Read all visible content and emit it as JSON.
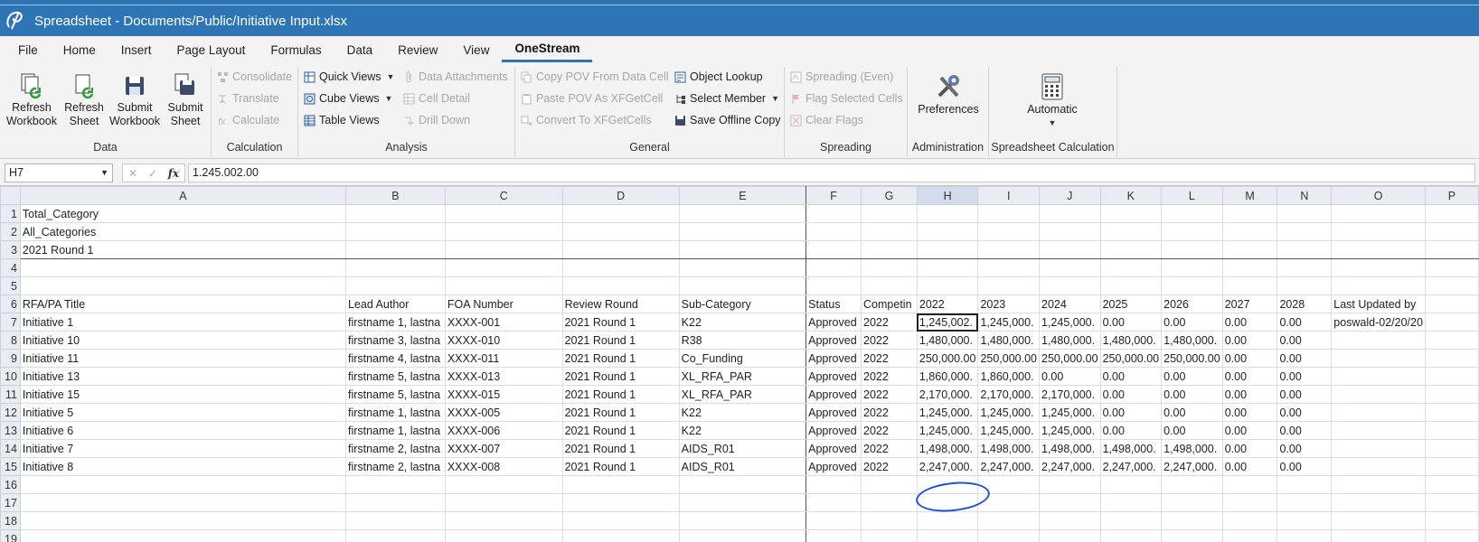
{
  "window": {
    "title": "Spreadsheet - Documents/Public/Initiative Input.xlsx"
  },
  "menu": [
    "File",
    "Home",
    "Insert",
    "Page Layout",
    "Formulas",
    "Data",
    "Review",
    "View",
    "OneStream"
  ],
  "active_menu": "OneStream",
  "ribbon": {
    "data": {
      "label": "Data",
      "buttons": [
        {
          "line1": "Refresh",
          "line2": "Workbook"
        },
        {
          "line1": "Refresh",
          "line2": "Sheet"
        },
        {
          "line1": "Submit",
          "line2": "Workbook"
        },
        {
          "line1": "Submit",
          "line2": "Sheet"
        }
      ]
    },
    "calculation": {
      "label": "Calculation",
      "items": [
        "Consolidate",
        "Translate",
        "Calculate"
      ]
    },
    "analysis": {
      "label": "Analysis",
      "items": [
        "Quick Views",
        "Cube Views",
        "Table Views",
        "Data Attachments",
        "Cell Detail",
        "Drill Down"
      ]
    },
    "general": {
      "label": "General",
      "items": [
        "Copy POV From Data Cell",
        "Paste POV As XFGetCell",
        "Convert To XFGetCells",
        "Object Lookup",
        "Select Member",
        "Save Offline Copy"
      ]
    },
    "spreading": {
      "label": "Spreading",
      "items": [
        "Spreading (Even)",
        "Flag Selected Cells",
        "Clear Flags"
      ]
    },
    "administration": {
      "label": "Administration",
      "button": "Preferences"
    },
    "spreadsheet_calc": {
      "label": "Spreadsheet Calculation",
      "button": "Automatic"
    }
  },
  "formula_bar": {
    "name_box": "H7",
    "formula": "1.245.002.00"
  },
  "columns": [
    "A",
    "B",
    "C",
    "D",
    "E",
    "F",
    "G",
    "H",
    "I",
    "J",
    "K",
    "L",
    "M",
    "N",
    "O",
    "P"
  ],
  "selected_column": "H",
  "rows": [
    {
      "n": "1",
      "cells": [
        "Total_Category",
        "",
        "",
        "",
        "",
        "",
        "",
        "",
        "",
        "",
        "",
        "",
        "",
        "",
        "",
        ""
      ]
    },
    {
      "n": "2",
      "cells": [
        "All_Categories",
        "",
        "",
        "",
        "",
        "",
        "",
        "",
        "",
        "",
        "",
        "",
        "",
        "",
        "",
        ""
      ]
    },
    {
      "n": "3",
      "cells": [
        "2021 Round 1",
        "",
        "",
        "",
        "",
        "",
        "",
        "",
        "",
        "",
        "",
        "",
        "",
        "",
        "",
        ""
      ]
    },
    {
      "n": "4",
      "cells": [
        "",
        "",
        "",
        "",
        "",
        "",
        "",
        "",
        "",
        "",
        "",
        "",
        "",
        "",
        "",
        ""
      ]
    },
    {
      "n": "5",
      "cells": [
        "",
        "",
        "",
        "",
        "",
        "",
        "",
        "",
        "",
        "",
        "",
        "",
        "",
        "",
        "",
        ""
      ]
    },
    {
      "n": "6",
      "cells": [
        "RFA/PA Title",
        "Lead Author",
        "FOA Number",
        "Review Round",
        "Sub-Category",
        "Status",
        "Competin",
        "2022",
        "2023",
        "2024",
        "2025",
        "2026",
        "2027",
        "2028",
        "Last Updated by",
        ""
      ]
    },
    {
      "n": "7",
      "cells": [
        "Initiative 1",
        "firstname 1, lastna",
        "XXXX-001",
        "2021 Round 1",
        "K22",
        "Approved",
        "2022",
        "1,245,002.",
        "1,245,000.",
        "1,245,000.",
        "0.00",
        "0.00",
        "0.00",
        "0.00",
        "poswald-02/20/20",
        ""
      ]
    },
    {
      "n": "8",
      "cells": [
        "Initiative 10",
        "firstname 3, lastna",
        "XXXX-010",
        "2021 Round 1",
        "R38",
        "Approved",
        "2022",
        "1,480,000.",
        "1,480,000.",
        "1,480,000.",
        "1,480,000.",
        "1,480,000.",
        "0.00",
        "0.00",
        "",
        ""
      ]
    },
    {
      "n": "9",
      "cells": [
        "Initiative 11",
        "firstname 4, lastna",
        "XXXX-011",
        "2021 Round 1",
        "Co_Funding",
        "Approved",
        "2022",
        "250,000.00",
        "250,000.00",
        "250,000.00",
        "250,000.00",
        "250,000.00",
        "0.00",
        "0.00",
        "",
        ""
      ]
    },
    {
      "n": "10",
      "cells": [
        "Initiative 13",
        "firstname 5, lastna",
        "XXXX-013",
        "2021 Round 1",
        "XL_RFA_PAR",
        "Approved",
        "2022",
        "1,860,000.",
        "1,860,000.",
        "0.00",
        "0.00",
        "0.00",
        "0.00",
        "0.00",
        "",
        ""
      ]
    },
    {
      "n": "11",
      "cells": [
        "Initiative 15",
        "firstname 5, lastna",
        "XXXX-015",
        "2021 Round 1",
        "XL_RFA_PAR",
        "Approved",
        "2022",
        "2,170,000.",
        "2,170,000.",
        "2,170,000.",
        "0.00",
        "0.00",
        "0.00",
        "0.00",
        "",
        ""
      ]
    },
    {
      "n": "12",
      "cells": [
        "Initiative 5",
        "firstname 1, lastna",
        "XXXX-005",
        "2021 Round 1",
        "K22",
        "Approved",
        "2022",
        "1,245,000.",
        "1,245,000.",
        "1,245,000.",
        "0.00",
        "0.00",
        "0.00",
        "0.00",
        "",
        ""
      ]
    },
    {
      "n": "13",
      "cells": [
        "Initiative 6",
        "firstname 1, lastna",
        "XXXX-006",
        "2021 Round 1",
        "K22",
        "Approved",
        "2022",
        "1,245,000.",
        "1,245,000.",
        "1,245,000.",
        "0.00",
        "0.00",
        "0.00",
        "0.00",
        "",
        ""
      ]
    },
    {
      "n": "14",
      "cells": [
        "Initiative 7",
        "firstname 2, lastna",
        "XXXX-007",
        "2021 Round 1",
        "AIDS_R01",
        "Approved",
        "2022",
        "1,498,000.",
        "1,498,000.",
        "1,498,000.",
        "1,498,000.",
        "1,498,000.",
        "0.00",
        "0.00",
        "",
        ""
      ]
    },
    {
      "n": "15",
      "cells": [
        "Initiative 8",
        "firstname 2, lastna",
        "XXXX-008",
        "2021 Round 1",
        "AIDS_R01",
        "Approved",
        "2022",
        "2,247,000.",
        "2,247,000.",
        "2,247,000.",
        "2,247,000.",
        "2,247,000.",
        "0.00",
        "0.00",
        "",
        ""
      ]
    },
    {
      "n": "16",
      "cells": [
        "",
        "",
        "",
        "",
        "",
        "",
        "",
        "",
        "",
        "",
        "",
        "",
        "",
        "",
        "",
        ""
      ]
    },
    {
      "n": "17",
      "cells": [
        "",
        "",
        "",
        "",
        "",
        "",
        "",
        "",
        "",
        "",
        "",
        "",
        "",
        "",
        "",
        ""
      ]
    },
    {
      "n": "18",
      "cells": [
        "",
        "",
        "",
        "",
        "",
        "",
        "",
        "",
        "",
        "",
        "",
        "",
        "",
        "",
        "",
        ""
      ]
    },
    {
      "n": "19",
      "cells": [
        "",
        "",
        "",
        "",
        "",
        "",
        "",
        "",
        "",
        "",
        "",
        "",
        "",
        "",
        "",
        ""
      ]
    }
  ],
  "active_cell": {
    "row": "7",
    "col": "H"
  },
  "colors": {
    "title_bar": "#2e75b6",
    "annotation_circle": "#1f4fd8"
  }
}
